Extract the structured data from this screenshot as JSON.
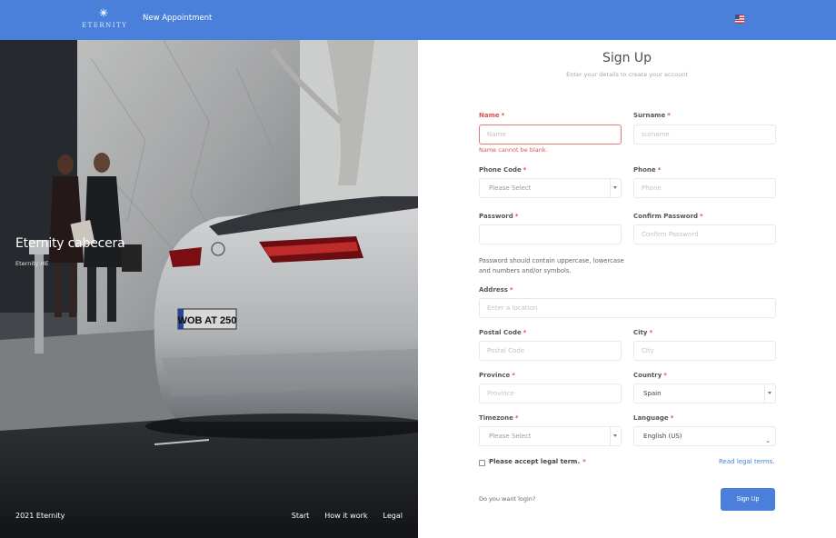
{
  "header": {
    "logo_text": "ETERNITY",
    "new_appointment_label": "New Appointment",
    "language_flag": "us-flag-icon",
    "accent_color": "#4a80d9"
  },
  "hero": {
    "title": "Eternity cabecera",
    "subtitle": "Eternity HE",
    "plate_text": "WOB AT 250",
    "copyright": "2021 Eternity",
    "links": [
      "Start",
      "How it work",
      "Legal"
    ]
  },
  "form": {
    "title": "Sign Up",
    "subtitle": "Enter your details to create your account",
    "name": {
      "label": "Name",
      "placeholder": "Name",
      "error": "Name cannot be blank."
    },
    "surname": {
      "label": "Surname",
      "placeholder": "surname"
    },
    "phone_code": {
      "label": "Phone Code",
      "value": "Please Select"
    },
    "phone": {
      "label": "Phone",
      "placeholder": "Phone"
    },
    "password": {
      "label": "Password",
      "placeholder": ""
    },
    "confirm_password": {
      "label": "Confirm Password",
      "placeholder": "Confirm Password"
    },
    "password_hint": "Password should contain uppercase, lowercase and numbers and/or symbols.",
    "address": {
      "label": "Address",
      "placeholder": "Enter a location"
    },
    "postal_code": {
      "label": "Postal Code",
      "placeholder": "Postal Code"
    },
    "city": {
      "label": "City",
      "placeholder": "City"
    },
    "province": {
      "label": "Province",
      "placeholder": "Province"
    },
    "country": {
      "label": "Country",
      "value": "Spain"
    },
    "timezone": {
      "label": "Timezone",
      "value": "Please Select"
    },
    "language": {
      "label": "Language",
      "value": "English (US)"
    },
    "legal_checkbox_label": "Please accept legal term.",
    "read_legal_link": "Read legal terms.",
    "login_prompt": "Do you want login?",
    "signup_button": "Sign Up",
    "required_mark": "*",
    "error_color": "#d9534f"
  }
}
